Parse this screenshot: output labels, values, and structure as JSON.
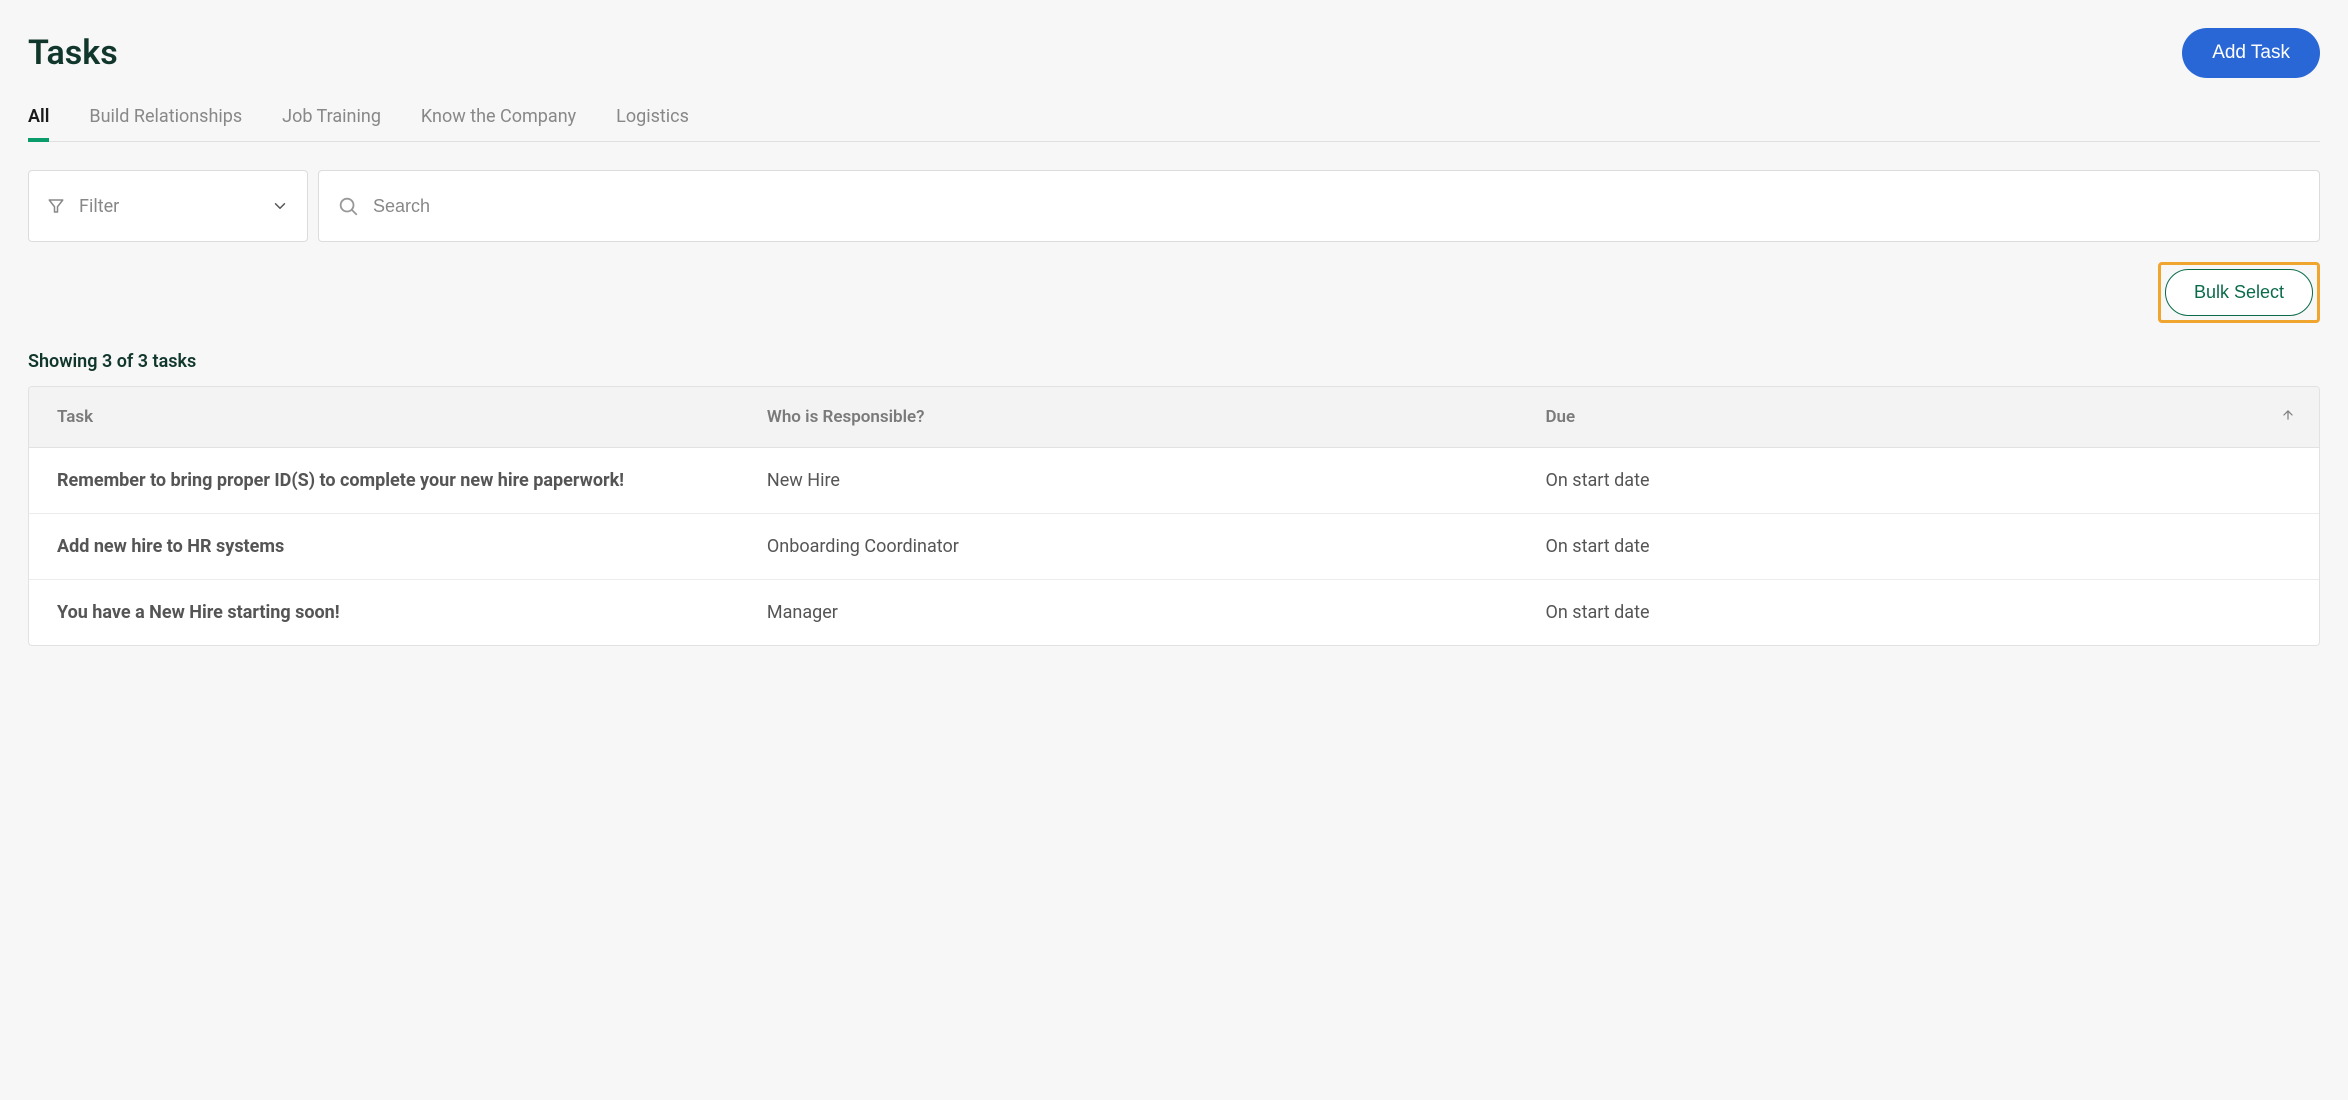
{
  "header": {
    "title": "Tasks",
    "addTaskLabel": "Add Task"
  },
  "tabs": [
    {
      "label": "All",
      "active": true
    },
    {
      "label": "Build Relationships",
      "active": false
    },
    {
      "label": "Job Training",
      "active": false
    },
    {
      "label": "Know the Company",
      "active": false
    },
    {
      "label": "Logistics",
      "active": false
    }
  ],
  "filter": {
    "label": "Filter"
  },
  "search": {
    "placeholder": "Search"
  },
  "bulkSelect": {
    "label": "Bulk Select"
  },
  "summary": "Showing 3 of 3 tasks",
  "table": {
    "columns": {
      "task": "Task",
      "who": "Who is Responsible?",
      "due": "Due"
    },
    "rows": [
      {
        "task": "Remember to bring proper ID(S) to complete your new hire paperwork!",
        "who": "New Hire",
        "due": "On start date"
      },
      {
        "task": "Add new hire to HR systems",
        "who": "Onboarding Coordinator",
        "due": "On start date"
      },
      {
        "task": "You have a New Hire starting soon!",
        "who": "Manager",
        "due": "On start date"
      }
    ]
  }
}
